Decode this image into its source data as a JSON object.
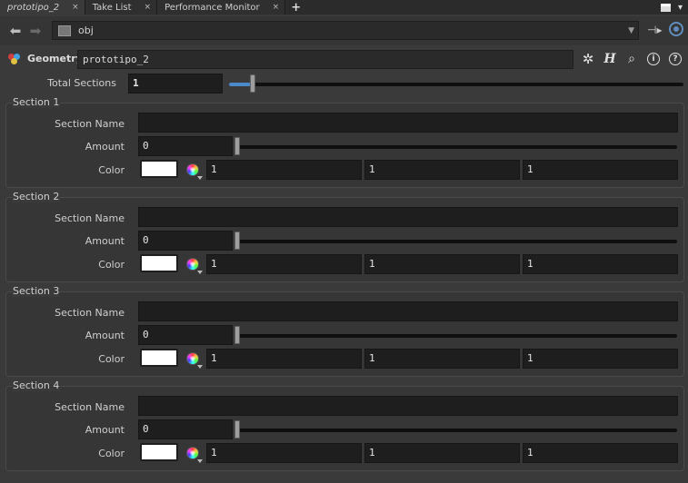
{
  "tabs": [
    {
      "label": "prototipo_2",
      "active": true
    },
    {
      "label": "Take List",
      "active": false
    },
    {
      "label": "Performance Monitor",
      "active": false
    }
  ],
  "tab_close": "×",
  "tab_add": "+",
  "path": {
    "value": "obj"
  },
  "node": {
    "type_label": "Geometry",
    "name": "prototipo_2"
  },
  "header_icons": {
    "gear": "✲",
    "help_h": "H",
    "search": "⌕",
    "info": "i",
    "question": "?"
  },
  "total_sections": {
    "label": "Total Sections",
    "value": "1",
    "slider_fraction": 0.1
  },
  "sections": [
    {
      "title": "Section 1",
      "name_label": "Section Name",
      "name_value": "",
      "amount_label": "Amount",
      "amount_value": "0",
      "amount_fraction": 0,
      "color_label": "Color",
      "color_swatch": "#ffffff",
      "r": "1",
      "g": "1",
      "b": "1"
    },
    {
      "title": "Section 2",
      "name_label": "Section Name",
      "name_value": "",
      "amount_label": "Amount",
      "amount_value": "0",
      "amount_fraction": 0,
      "color_label": "Color",
      "color_swatch": "#ffffff",
      "r": "1",
      "g": "1",
      "b": "1"
    },
    {
      "title": "Section 3",
      "name_label": "Section Name",
      "name_value": "",
      "amount_label": "Amount",
      "amount_value": "0",
      "amount_fraction": 0,
      "color_label": "Color",
      "color_swatch": "#ffffff",
      "r": "1",
      "g": "1",
      "b": "1"
    },
    {
      "title": "Section 4",
      "name_label": "Section Name",
      "name_value": "",
      "amount_label": "Amount",
      "amount_value": "0",
      "amount_fraction": 0,
      "color_label": "Color",
      "color_swatch": "#ffffff",
      "r": "1",
      "g": "1",
      "b": "1"
    }
  ],
  "colors": {
    "accent": "#4b89c9",
    "background": "#3a3a3a",
    "field": "#1e1e1e"
  }
}
